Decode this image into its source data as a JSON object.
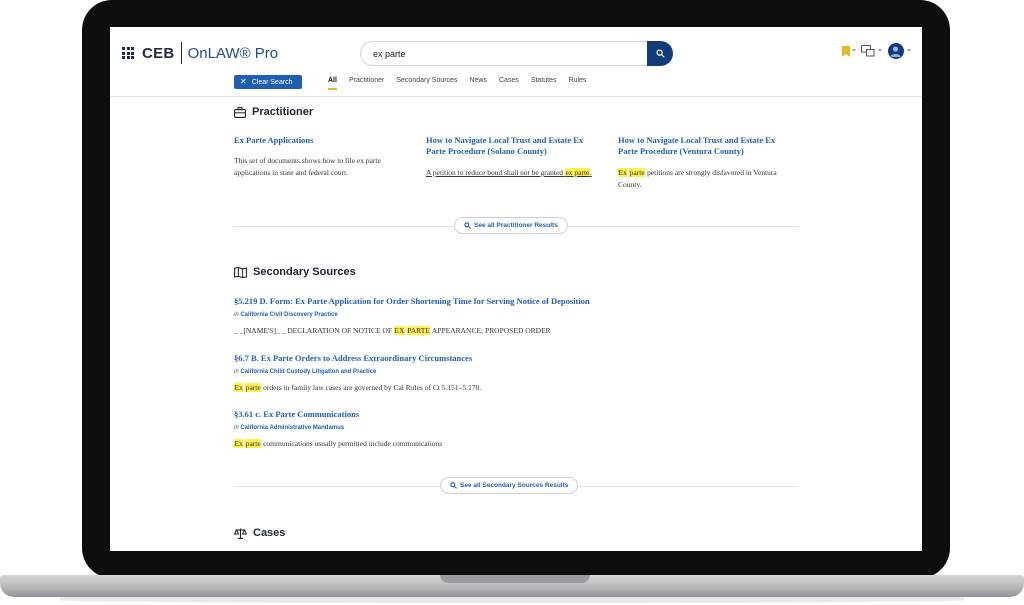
{
  "header": {
    "logo_ceb": "CEB",
    "logo_onlaw": "OnLAW® Pro",
    "search_value": "ex parte",
    "clear_search_label": "Clear Search",
    "colors": {
      "navy": "#123b7a",
      "link": "#1f5fb0",
      "accent": "#e8b824",
      "highlight": "#fff04a"
    }
  },
  "tabs": [
    {
      "label": "All",
      "active": true
    },
    {
      "label": "Practitioner"
    },
    {
      "label": "Secondary Sources"
    },
    {
      "label": "News"
    },
    {
      "label": "Cases"
    },
    {
      "label": "Statutes"
    },
    {
      "label": "Rules"
    }
  ],
  "practitioner": {
    "heading": "Practitioner",
    "cards": [
      {
        "title": "Ex Parte Applications",
        "snippet": "This set of documents shows how to file ex parte applications in state and federal court."
      },
      {
        "title": "How to Navigate Local Trust and Estate Ex Parte Procedure (Solano County)",
        "snippet_pre": "A petition to reduce bond shall not be granted",
        "snippet_hl": "ex parte",
        "snippet_post": "."
      },
      {
        "title": "How to Navigate Local Trust and Estate Ex Parte Procedure (Ventura County)",
        "snippet_hl1": "Ex",
        "snippet_hl2": "parte",
        "snippet_post": "petitions are strongly disfavored in Ventura County."
      }
    ],
    "see_all": "See all Practitioner Results"
  },
  "secondary": {
    "heading": "Secondary Sources",
    "in_label": "in",
    "results": [
      {
        "title": "§5.219 D. Form: Ex Parte Application for Order Shortening Time for Serving Notice of Deposition",
        "source": "California Civil Discovery Practice",
        "snippet_pre": "_ _[NAME'S]_ _ DECLARATION OF NOTICE OF",
        "snippet_hl1": "EX",
        "snippet_hl2": "PARTE",
        "snippet_post": "APPEARANCE; PROPOSED ORDER"
      },
      {
        "title": "§6.7 B. Ex Parte Orders to Address Extraordinary Circumstances",
        "source": "California Child Custody Litigation and Practice",
        "snippet_hl1": "Ex",
        "snippet_hl2": "parte",
        "snippet_post": "orders in family law cases are governed by Cal Rules of Ct 5.151–5.170."
      },
      {
        "title": "§3.61 c. Ex Parte Communications",
        "source": "California Administrative Mandamus",
        "snippet_hl1": "Ex",
        "snippet_hl2": "parte",
        "snippet_post": "communications usually permitted include communications"
      }
    ],
    "see_all": "See all Secondary Sources Results"
  },
  "cases": {
    "heading": "Cases"
  }
}
